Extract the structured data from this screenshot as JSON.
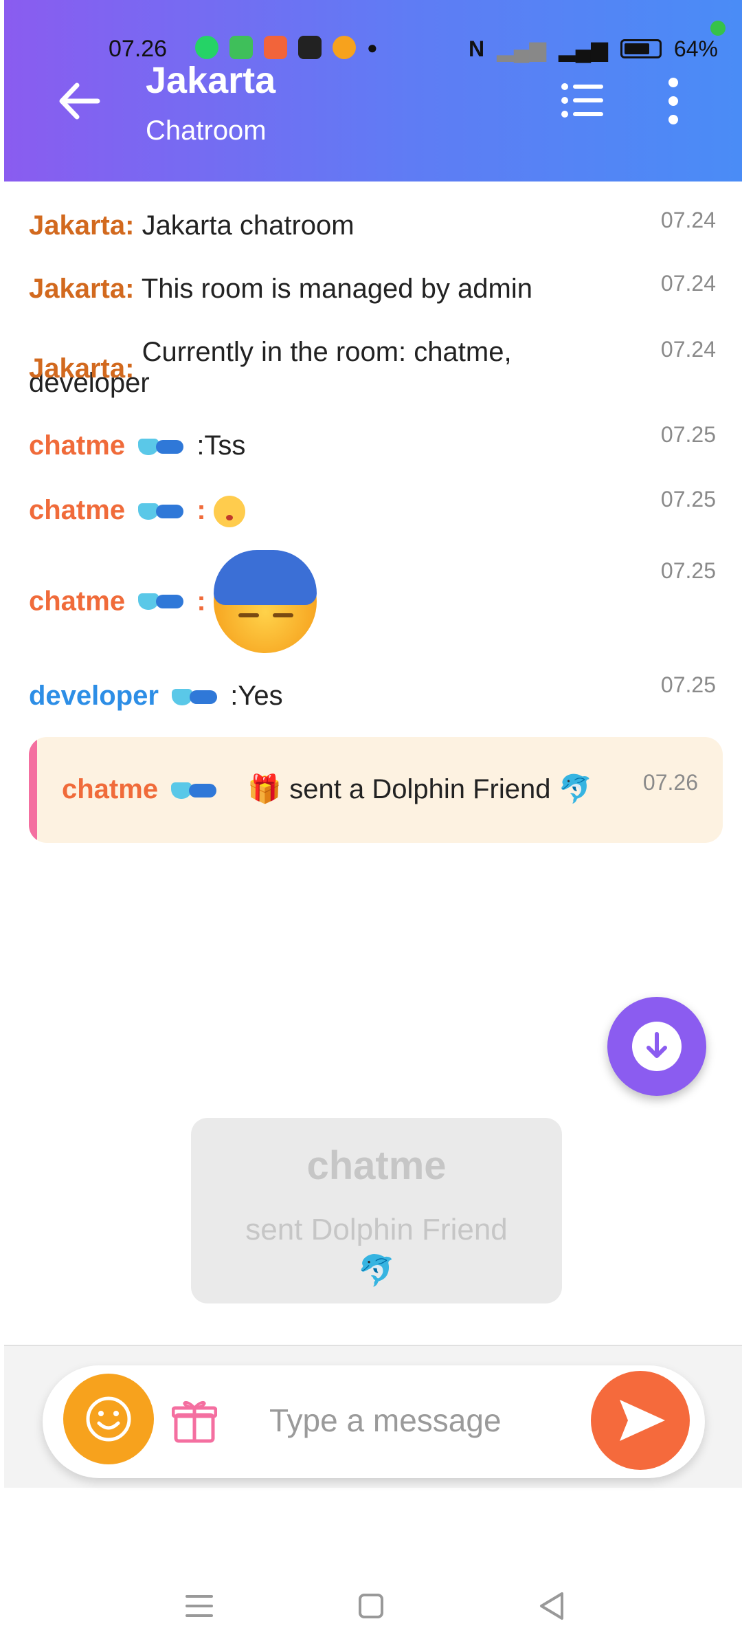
{
  "status_bar": {
    "time": "07.26",
    "battery_percent": "64%"
  },
  "header": {
    "title": "Jakarta",
    "subtitle": "Chatroom"
  },
  "messages": [
    {
      "sender": "Jakarta:",
      "text": "Jakarta chatroom",
      "time": "07.24"
    },
    {
      "sender": "Jakarta:",
      "text": "This room is managed by admin",
      "time": "07.24"
    },
    {
      "sender": "Jakarta:",
      "text": "Currently in the room: chatme, developer",
      "time": "07.24"
    },
    {
      "sender": "chatme",
      "text": ":Tss",
      "time": "07.25"
    },
    {
      "sender": "chatme",
      "text": ":",
      "time": "07.25"
    },
    {
      "sender": "chatme",
      "text": ":",
      "time": "07.25"
    },
    {
      "sender": "developer",
      "text": ":Yes",
      "time": "07.25"
    }
  ],
  "gift_message": {
    "sender": "chatme",
    "text": "sent a Dolphin Friend",
    "time": "07.26"
  },
  "toast": {
    "user": "chatme",
    "text": "sent Dolphin Friend"
  },
  "composer": {
    "placeholder": "Type a message"
  },
  "colors": {
    "header_start": "#8a5cf0",
    "header_end": "#4a8cf6",
    "system_sender": "#d2691e",
    "user_sender": "#f06b3a",
    "developer_sender": "#2d8ee6",
    "send_button": "#f56a3c",
    "emoji_button": "#f7a21d",
    "scroll_button": "#8b5cf0"
  }
}
